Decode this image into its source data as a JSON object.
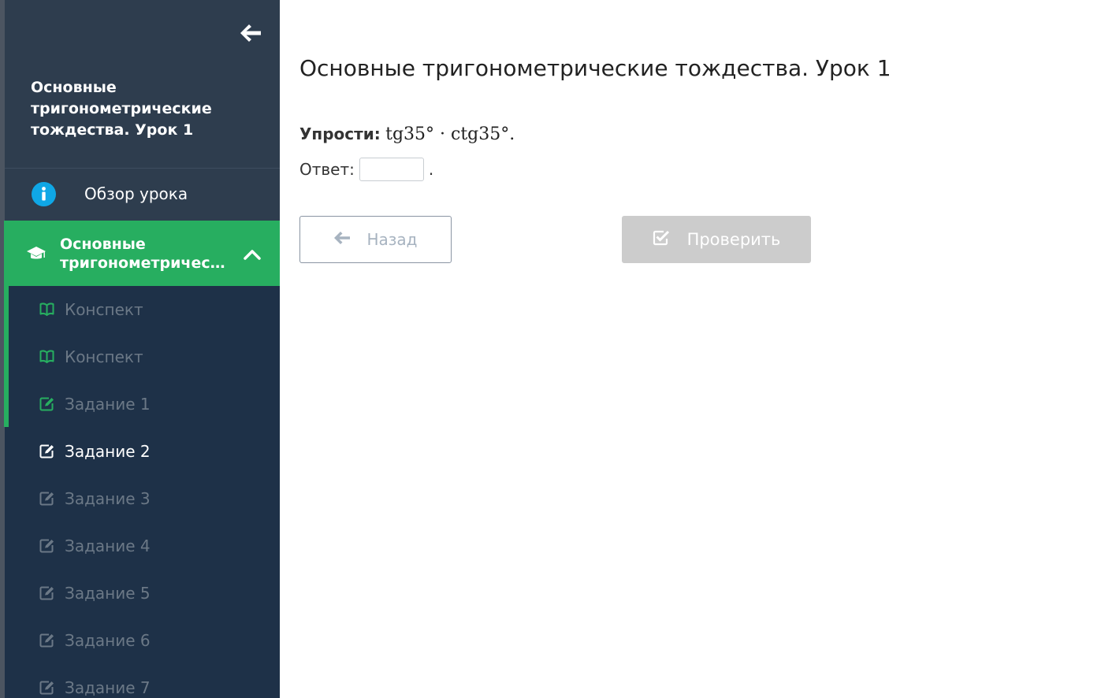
{
  "sidebar": {
    "lesson_title": "Основные тригонометрические тождества. Урок 1",
    "overview_label": "Обзор урока",
    "section": {
      "title_line1": "Основные",
      "title_line2": "тригонометрическ..."
    },
    "items": [
      {
        "label": "Конспект",
        "icon": "book-icon",
        "state": "done"
      },
      {
        "label": "Конспект",
        "icon": "book-icon",
        "state": "done"
      },
      {
        "label": "Задание 1",
        "icon": "edit-icon",
        "state": "done"
      },
      {
        "label": "Задание 2",
        "icon": "edit-icon",
        "state": "active"
      },
      {
        "label": "Задание 3",
        "icon": "edit-icon",
        "state": "locked"
      },
      {
        "label": "Задание 4",
        "icon": "edit-icon",
        "state": "locked"
      },
      {
        "label": "Задание 5",
        "icon": "edit-icon",
        "state": "locked"
      },
      {
        "label": "Задание 6",
        "icon": "edit-icon",
        "state": "locked"
      },
      {
        "label": "Задание 7",
        "icon": "edit-icon",
        "state": "locked"
      }
    ]
  },
  "main": {
    "title": "Основные тригонометрические тождества. Урок 1",
    "task_lead": "Упрости:",
    "task_expression": "tg35° · ctg35°.",
    "answer_label": "Ответ:",
    "answer_value": "",
    "answer_suffix": ".",
    "back_button": "Назад",
    "check_button": "Проверить"
  },
  "colors": {
    "sidebar_bg": "#1e3148",
    "sidebar_header_bg": "#2e3d4e",
    "accent_green": "#27ae60",
    "info_blue": "#0fa7e6",
    "muted_text": "#6b7886",
    "check_disabled": "#cccccc"
  }
}
